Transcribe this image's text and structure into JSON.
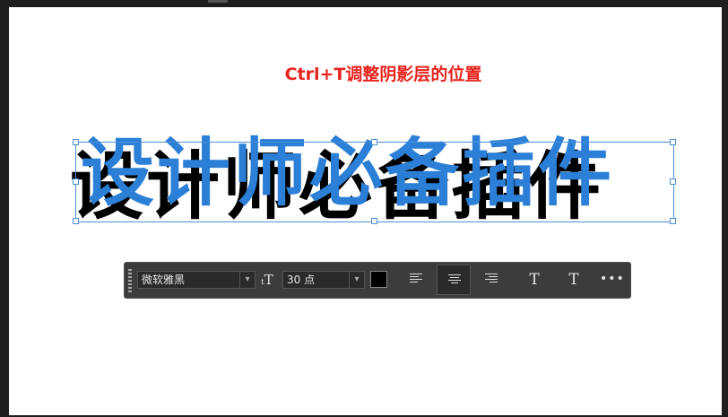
{
  "caption": "Ctrl+T调整阴影层的位置",
  "headline": "设计师必备插件",
  "toolbar": {
    "font_family": "微软雅黑",
    "font_size": "30 点",
    "size_icon": "ₜT",
    "color_swatch": "#000000",
    "align_left": "left",
    "align_center": "center",
    "align_right": "right",
    "warp_text_glyph": "T",
    "text_panel_glyph": "T",
    "more_glyph": "•••"
  },
  "colors": {
    "caption": "#e8231f",
    "headline_fill": "#2b7fd6",
    "headline_shadow": "#000000"
  }
}
